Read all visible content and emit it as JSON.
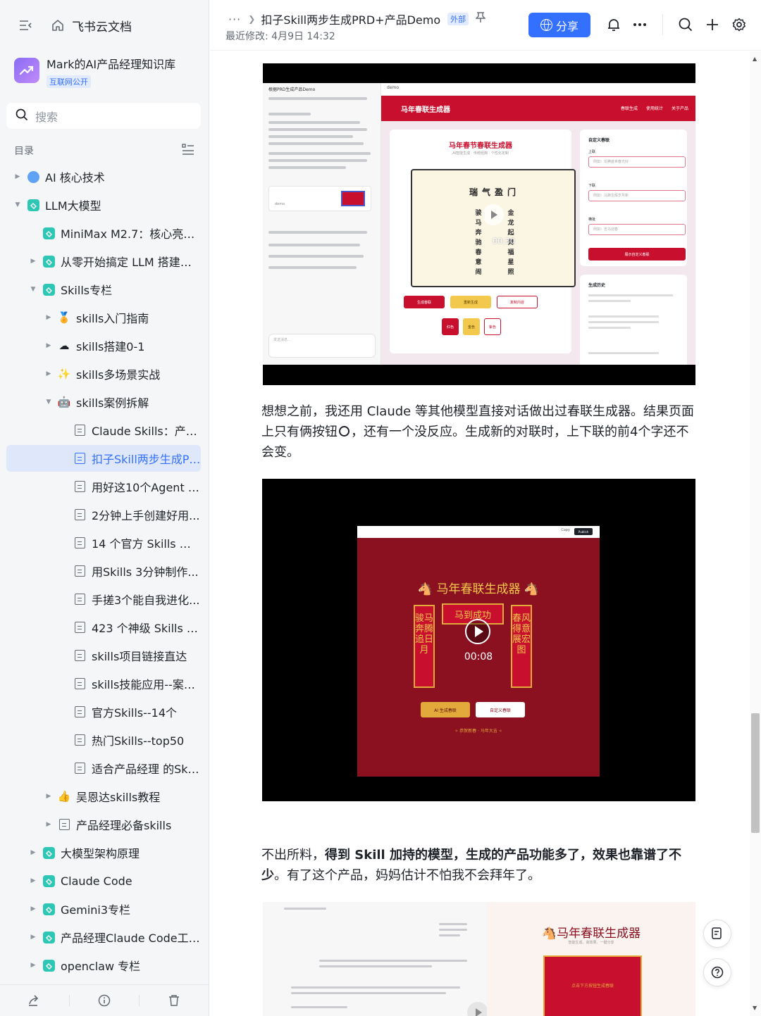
{
  "app": {
    "name": "飞书云文档"
  },
  "knowledge_base": {
    "title": "Mark的AI产品经理知识库",
    "badge": "互联网公开"
  },
  "search": {
    "placeholder": "搜索"
  },
  "toc": {
    "label": "目录"
  },
  "tree": [
    {
      "label": "AI 核心技术",
      "level": 0,
      "arrow": "right",
      "icon": "globe-icon"
    },
    {
      "label": "LLM大模型",
      "level": 0,
      "arrow": "down",
      "icon": "wiki-icon"
    },
    {
      "label": "MiniMax M2.7：核心亮点...",
      "level": 1,
      "arrow": "",
      "icon": "wiki-icon"
    },
    {
      "label": "从零开始搞定 LLM 搭建全...",
      "level": 1,
      "arrow": "right",
      "icon": "wiki-icon"
    },
    {
      "label": "Skills专栏",
      "level": 1,
      "arrow": "down",
      "icon": "wiki-icon"
    },
    {
      "label": "skills入门指南",
      "level": 2,
      "arrow": "right",
      "icon": "medal-icon"
    },
    {
      "label": "skills搭建0-1",
      "level": 2,
      "arrow": "right",
      "icon": "cloud-icon"
    },
    {
      "label": "skills多场景实战",
      "level": 2,
      "arrow": "right",
      "icon": "sparkle-icon"
    },
    {
      "label": "skills案例拆解",
      "level": 2,
      "arrow": "down",
      "icon": "robot-icon"
    },
    {
      "label": "Claude Skills：产品...",
      "level": 3,
      "arrow": "",
      "icon": "doc-icon"
    },
    {
      "label": "扣子Skill两步生成PR...",
      "level": 3,
      "arrow": "",
      "icon": "doc-icon",
      "active": true
    },
    {
      "label": "用好这10个Agent Sk...",
      "level": 3,
      "arrow": "",
      "icon": "doc-icon"
    },
    {
      "label": "2分钟上手创建好用...",
      "level": 3,
      "arrow": "",
      "icon": "doc-icon"
    },
    {
      "label": "14 个官方 Skills 宝...",
      "level": 3,
      "arrow": "",
      "icon": "doc-icon"
    },
    {
      "label": "用Skills 3分钟制作...",
      "level": 3,
      "arrow": "",
      "icon": "doc-icon"
    },
    {
      "label": "手搓3个能自我进化...",
      "level": 3,
      "arrow": "",
      "icon": "doc-icon"
    },
    {
      "label": "423 个神级 Skills —...",
      "level": 3,
      "arrow": "",
      "icon": "doc-icon"
    },
    {
      "label": "skills项目链接直达",
      "level": 3,
      "arrow": "",
      "icon": "doc-icon"
    },
    {
      "label": "skills技能应用--案例...",
      "level": 3,
      "arrow": "",
      "icon": "doc-icon"
    },
    {
      "label": "官方Skills--14个",
      "level": 3,
      "arrow": "",
      "icon": "doc-icon"
    },
    {
      "label": "热门Skills--top50",
      "level": 3,
      "arrow": "",
      "icon": "doc-icon"
    },
    {
      "label": "适合产品经理 的Skil...",
      "level": 3,
      "arrow": "",
      "icon": "doc-icon"
    },
    {
      "label": "吴恩达skills教程",
      "level": 2,
      "arrow": "right",
      "icon": "thumbs-up-icon"
    },
    {
      "label": "产品经理必备skills",
      "level": 2,
      "arrow": "right",
      "icon": "doc-icon"
    },
    {
      "label": "大模型架构原理",
      "level": 1,
      "arrow": "right",
      "icon": "wiki-icon"
    },
    {
      "label": "Claude Code",
      "level": 1,
      "arrow": "right",
      "icon": "wiki-icon"
    },
    {
      "label": "Gemini3专栏",
      "level": 1,
      "arrow": "right",
      "icon": "wiki-icon"
    },
    {
      "label": "产品经理Claude Code工作流",
      "level": 1,
      "arrow": "right",
      "icon": "wiki-icon"
    },
    {
      "label": "openclaw 专栏",
      "level": 1,
      "arrow": "right",
      "icon": "wiki-icon"
    }
  ],
  "header": {
    "ellipsis": "···",
    "doc_title": "扣子Skill两步生成PRD+产品Demo",
    "ext_badge": "外部",
    "last_modified": "最近修改: 4月9日 14:32",
    "share_label": "分享"
  },
  "content": {
    "para1": "想想之前，我还用 Claude 等其他模型直接对话做出过春联生成器。结果页面上只有俩按钮",
    "para1_tail": "，还有一个没反应。生成新的对联时，上下联的前4个字还不会变。",
    "para2_a": "不出所料，",
    "para2_bold": "得到 Skill 加持的模型，生成的产品功能多了，效果也靠谱了不少",
    "para2_c": "。有了这个产品，妈妈估计不怕我不会拜年了。"
  },
  "media1": {
    "chat_title": "根据PRD生成产品Demo",
    "demo_label": "demo",
    "app_title": "马年春联生成器",
    "tabs": [
      "春联生成",
      "使用统计",
      "关于产品"
    ],
    "card_title": "马年春节春联生成器",
    "card_subtitle": "AI智能生成 · 传统经典 · 个性化定制",
    "hengpi": "瑞气盈门",
    "upper": "骏马奔驰春意闹",
    "lower": "金龙起舞福星照",
    "time": "00:30",
    "buttons": [
      "生成春联",
      "重新生成",
      "复制内容"
    ],
    "colors": [
      "红色",
      "金色",
      "紫色"
    ],
    "custom_title": "自定义春联",
    "custom_fields": [
      "上联",
      "下联",
      "横批"
    ],
    "custom_placeholders": [
      "例如：龙腾盛世春光好",
      "例如：马蹄生辉岁月新",
      "例如：吉马迎春"
    ],
    "custom_button": "展示自定义春联",
    "history_title": "生成历史",
    "chat_input": "发送消息..."
  },
  "media2": {
    "title": "马年春联生成器",
    "hengpi": "马到成功",
    "upper": "骏马奔腾追日月",
    "lower": "春风得意展宏图",
    "time": "00:08",
    "btn_ai": "AI 生成春联",
    "btn_custom": "自定义春联",
    "footer": "✧ 恭贺新春 · 马年大吉 ✧",
    "copy": "Copy",
    "publish": "Publish"
  },
  "media3": {
    "title": "马年春联生成器",
    "subtitle": "智能生成、高效果、一键分享",
    "box_text": "点击下方按钮生成春联"
  },
  "colors": {
    "accent": "#3370ff",
    "festival_red": "#c8102e",
    "gold": "#e3a93a"
  }
}
